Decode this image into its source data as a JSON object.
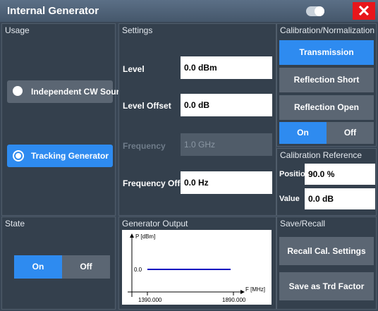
{
  "window": {
    "title": "Internal Generator",
    "close_glyph": "✕"
  },
  "usage": {
    "title": "Usage",
    "options": [
      {
        "label": "Independent CW Source",
        "selected": false
      },
      {
        "label": "Tracking Generator",
        "selected": true
      }
    ]
  },
  "settings": {
    "title": "Settings",
    "fields": [
      {
        "label": "Level",
        "value": "0.0 dBm",
        "enabled": true
      },
      {
        "label": "Level Offset",
        "value": "0.0 dB",
        "enabled": true
      },
      {
        "label": "Frequency",
        "value": "1.0 GHz",
        "enabled": false
      },
      {
        "label": "Frequency Offset",
        "value": "0.0 Hz",
        "enabled": true
      }
    ]
  },
  "calibration": {
    "title": "Calibration/Normalization",
    "buttons": [
      {
        "label": "Transmission",
        "active": true
      },
      {
        "label": "Reflection Short",
        "active": false
      },
      {
        "label": "Reflection Open",
        "active": false
      }
    ],
    "toggle": {
      "on_label": "On",
      "off_label": "Off",
      "value": "On"
    }
  },
  "calibration_reference": {
    "title": "Calibration Reference",
    "position_label": "Position",
    "position_value": "90.0 %",
    "value_label": "Value",
    "value_value": "0.0 dB"
  },
  "state": {
    "title": "State",
    "on_label": "On",
    "off_label": "Off",
    "value": "On"
  },
  "generator_output": {
    "title": "Generator Output",
    "y_label": "P [dBm]",
    "x_label": "F [MHz]",
    "level_label": "0.0",
    "x_start": "1390.000",
    "x_end": "1890.000",
    "line_color": "#1010c0"
  },
  "save_recall": {
    "title": "Save/Recall",
    "recall_label": "Recall Cal. Settings",
    "save_label": "Save as Trd Factor"
  },
  "colors": {
    "accent": "#2e8bf0",
    "close": "#e8161b"
  }
}
